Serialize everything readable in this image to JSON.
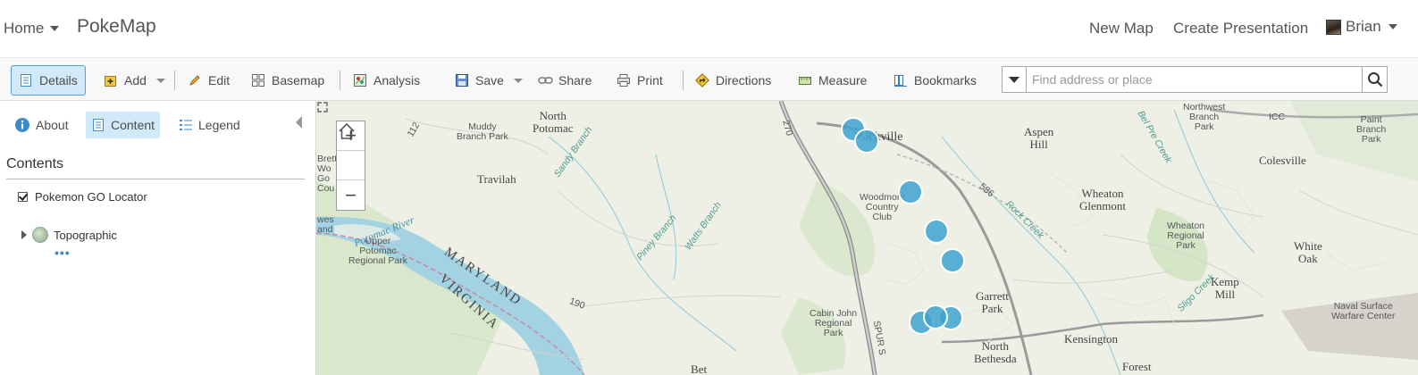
{
  "header": {
    "home_label": "Home",
    "app_title": "PokeMap",
    "new_map": "New Map",
    "create_presentation": "Create Presentation",
    "user_name": "Brian"
  },
  "toolbar": {
    "details": "Details",
    "add": "Add",
    "edit": "Edit",
    "basemap": "Basemap",
    "analysis": "Analysis",
    "save": "Save",
    "share": "Share",
    "print": "Print",
    "directions": "Directions",
    "measure": "Measure",
    "bookmarks": "Bookmarks"
  },
  "search": {
    "placeholder": "Find address or place",
    "value": ""
  },
  "panel": {
    "tabs": {
      "about": "About",
      "content": "Content",
      "legend": "Legend"
    },
    "heading": "Contents",
    "layers": [
      {
        "name": "Pokemon GO Locator",
        "checked": true
      },
      {
        "name": "Topographic"
      }
    ],
    "more": "•••"
  },
  "map": {
    "zoom_in": "+",
    "zoom_out": "−",
    "labels": {
      "north_potomac": "North\nPotomac",
      "muddy_branch_park": "Muddy\nBranch Park",
      "travilah": "Travilah",
      "rockville": "Rockville",
      "woodmont": "Woodmont\nCountry\nClub",
      "aspen_hill": "Aspen\nHill",
      "wheaton_glenmont": "Wheaton\nGlenmont",
      "wheaton_park": "Wheaton\nRegional\nPark",
      "colesville": "Colesville",
      "northwest_branch": "Northwest\nBranch\nPark",
      "paint_branch": "Paint\nBranch\nPark",
      "white_oak": "White\nOak",
      "kemp_mill": "Kemp\nMill",
      "naval": "Naval Surface\nWarfare Center",
      "garrett_park": "Garrett\nPark",
      "kensington": "Kensington",
      "north_bethesda": "North\nBethesda",
      "cabin_john": "Cabin John\nRegional\nPark",
      "upper_potomac": "Upper\nPotomac\nRegional Park",
      "potomac_river": "Potomac River",
      "maryland": "MARYLAND",
      "virginia": "VIRGINIA",
      "sandy_branch": "Sandy Branch",
      "piney_branch": "Piney Branch",
      "watts_branch": "Watts Branch",
      "rock_creek": "Rock Creek",
      "sligo_creek": "Sligo Creek",
      "bel_pre_creek": "Bel Pre Creek",
      "route_270": "270",
      "route_586": "586",
      "route_190": "190",
      "route_112": "112",
      "icc": "ICC",
      "spur": "SPUR S",
      "forest": "Forest",
      "bet": "Bet",
      "brett": "Brett\nWo\nGo\nCou",
      "island": "wes\nand"
    },
    "marker_color": "#3ea3cf"
  },
  "colors": {
    "accent_blue": "#3d8bc9",
    "active_bg": "#d2e9f9",
    "water": "#a3d3e2",
    "land": "#eef0e6",
    "park": "#cfe3c2"
  }
}
